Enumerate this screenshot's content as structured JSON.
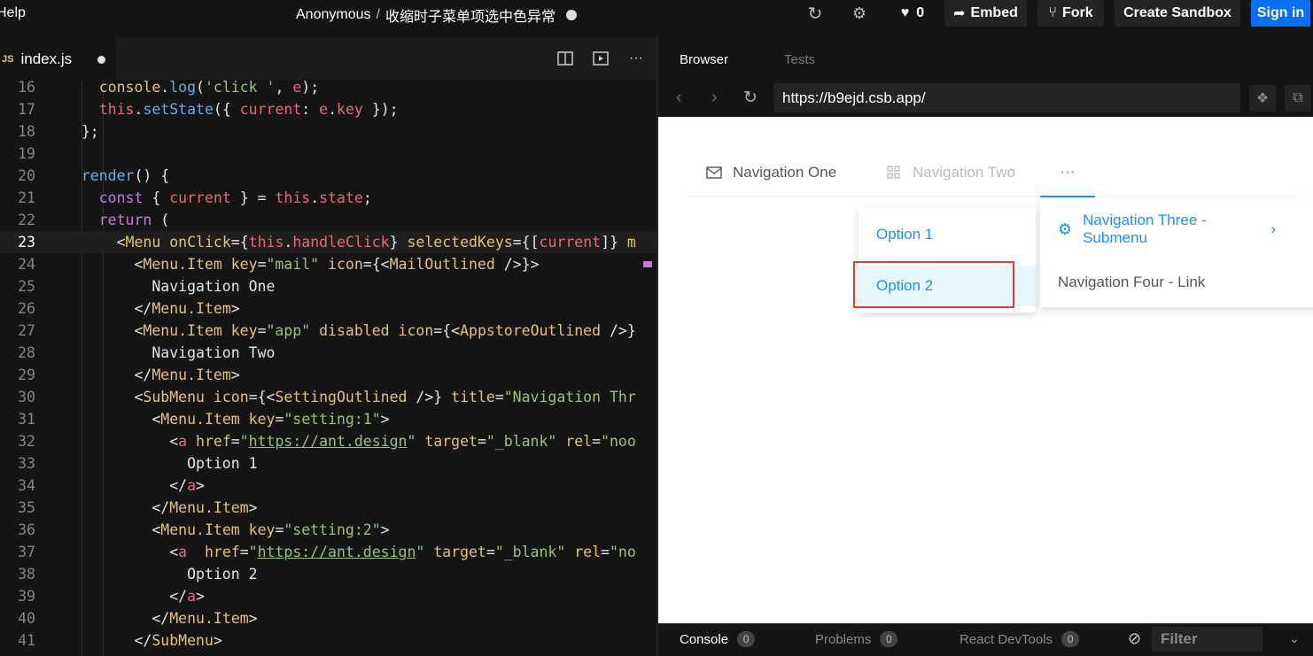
{
  "topbar": {
    "help": "Help",
    "owner": "Anonymous",
    "separator": "/",
    "sandbox_name": "收缩时子菜单项选中色异常",
    "like_count": "0",
    "embed_label": "Embed",
    "fork_label": "Fork",
    "create_label": "Create Sandbox",
    "signin_label": "Sign in",
    "colors": {
      "signin_bg": "#0971f1"
    }
  },
  "editor": {
    "file_icon_label": "JS",
    "file_name": "index.js",
    "current_line": "23"
  },
  "browser": {
    "tabs": [
      "Browser",
      "Tests"
    ],
    "url": "https://b9ejd.csb.app/"
  },
  "preview": {
    "menu": {
      "item1": "Navigation One",
      "item2": "Navigation Two",
      "more": "···"
    },
    "popup_options": [
      "Option 1",
      "Option 2"
    ],
    "popup_nav": [
      "Navigation Three - Submenu",
      "Navigation Four - Link"
    ],
    "colors": {
      "primary": "#1890ff",
      "highlight_bg": "#e6f7ff",
      "annotation_box": "#e53935"
    }
  },
  "console": {
    "tabs": [
      {
        "label": "Console",
        "count": "0"
      },
      {
        "label": "Problems",
        "count": "0"
      },
      {
        "label": "React DevTools",
        "count": "0"
      }
    ],
    "filter": "Filter"
  }
}
